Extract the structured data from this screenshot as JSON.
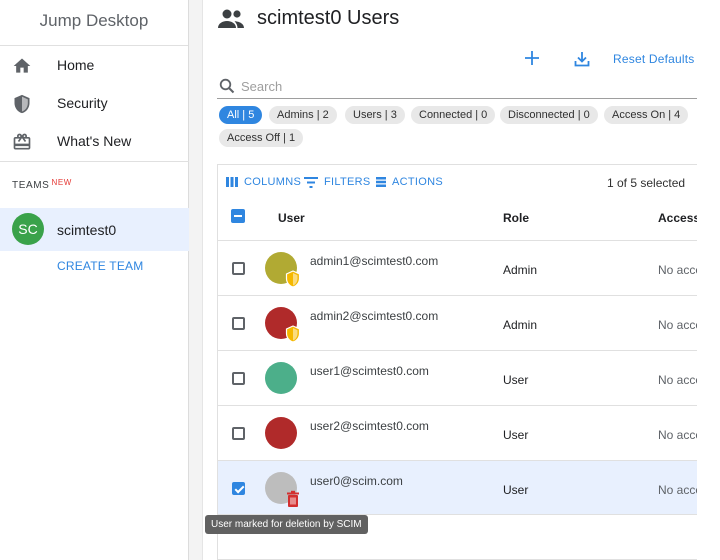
{
  "sidebar": {
    "app_title": "Jump Desktop",
    "nav": [
      {
        "label": "Home",
        "icon": "home-icon"
      },
      {
        "label": "Security",
        "icon": "shield-icon"
      },
      {
        "label": "What's New",
        "icon": "gift-icon"
      }
    ],
    "teams_label": "TEAMS",
    "teams_new_badge": "NEW",
    "team": {
      "initials": "SC",
      "name": "scimtest0",
      "avatar_color": "#3aa24a"
    },
    "create_team": "CREATE TEAM"
  },
  "header": {
    "title": "scimtest0 Users",
    "reset_defaults": "Reset Defaults",
    "search_placeholder": "Search"
  },
  "filters": [
    {
      "label": "All | 5",
      "active": true
    },
    {
      "label": "Admins | 2",
      "active": false
    },
    {
      "label": "Users | 3",
      "active": false
    },
    {
      "label": "Connected | 0",
      "active": false
    },
    {
      "label": "Disconnected | 0",
      "active": false
    },
    {
      "label": "Access On | 4",
      "active": false
    },
    {
      "label": "Access Off | 1",
      "active": false
    }
  ],
  "table": {
    "toolbar": {
      "columns": "COLUMNS",
      "filters": "FILTERS",
      "actions": "ACTIONS"
    },
    "selection_text": "1 of 5 selected",
    "headers": {
      "user": "User",
      "role": "Role",
      "access": "Access"
    },
    "rows": [
      {
        "email": "admin1@scimtest0.com",
        "role": "Admin",
        "access": "No access",
        "avatar_color": "#b1aa33",
        "badge": "admin-shield-icon",
        "checked": false
      },
      {
        "email": "admin2@scimtest0.com",
        "role": "Admin",
        "access": "No access",
        "avatar_color": "#b02a2a",
        "badge": "admin-shield-icon",
        "checked": false
      },
      {
        "email": "user1@scimtest0.com",
        "role": "User",
        "access": "No access",
        "avatar_color": "#4caf8a",
        "badge": "",
        "checked": false
      },
      {
        "email": "user2@scimtest0.com",
        "role": "User",
        "access": "No access",
        "avatar_color": "#b02a2a",
        "badge": "",
        "checked": false
      },
      {
        "email": "user0@scim.com",
        "role": "User",
        "access": "No access",
        "avatar_color": "#bdbdbd",
        "badge": "trash-icon",
        "checked": true
      }
    ]
  },
  "tooltip": "User marked for deletion by SCIM",
  "colors": {
    "accent": "#2f86e0",
    "selected_row": "#e8f0fe",
    "admin_badge": "#f5b800",
    "delete_badge": "#d32f2f"
  }
}
